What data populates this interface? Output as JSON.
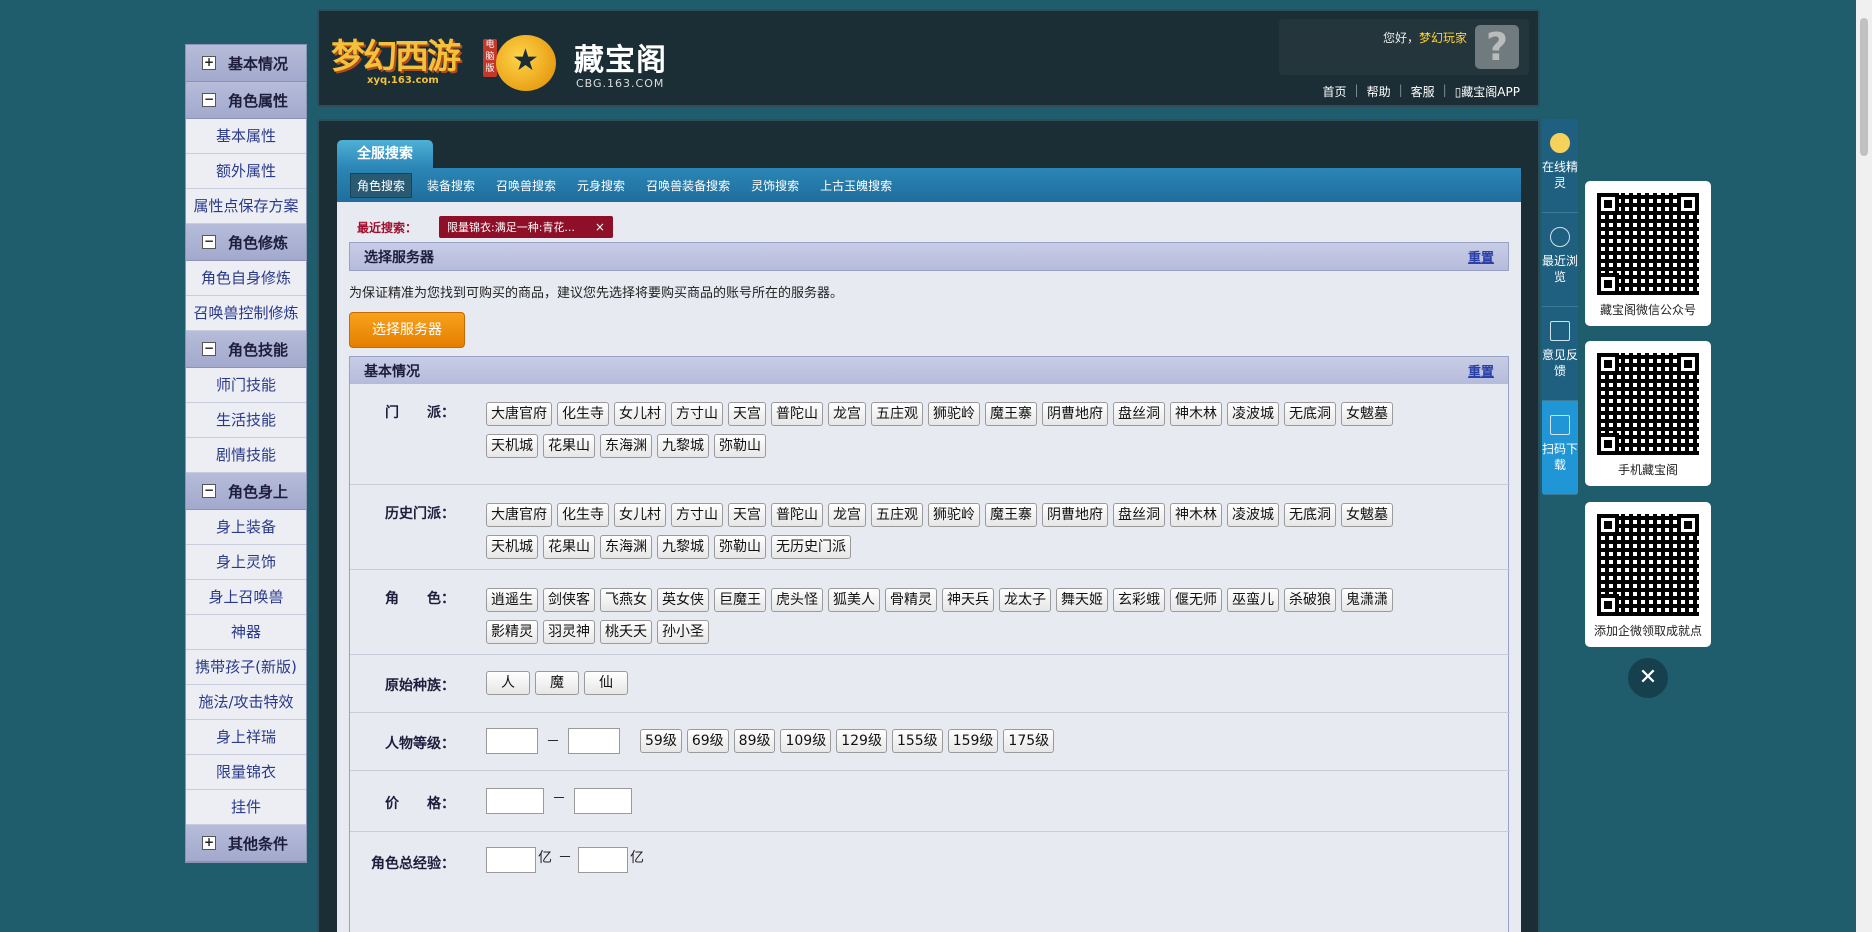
{
  "sidebar": {
    "groups": [
      {
        "toggle": "+",
        "label": "基本情况",
        "items": []
      },
      {
        "toggle": "−",
        "label": "角色属性",
        "items": [
          "基本属性",
          "额外属性",
          "属性点保存方案"
        ]
      },
      {
        "toggle": "−",
        "label": "角色修炼",
        "items": [
          "角色自身修炼",
          "召唤兽控制修炼"
        ]
      },
      {
        "toggle": "−",
        "label": "角色技能",
        "items": [
          "师门技能",
          "生活技能",
          "剧情技能"
        ]
      },
      {
        "toggle": "−",
        "label": "角色身上",
        "items": [
          "身上装备",
          "身上灵饰",
          "身上召唤兽",
          "神器",
          "携带孩子(新版)",
          "施法/攻击特效",
          "身上祥瑞",
          "限量锦衣",
          "挂件"
        ]
      },
      {
        "toggle": "+",
        "label": "其他条件",
        "items": []
      }
    ]
  },
  "header": {
    "logo1_brand": "梦幻西游",
    "logo1_url": "xyq.163.com",
    "logo1_tag": "电脑版",
    "logo2_name": "藏宝阁",
    "logo2_url": "CBG.163.COM",
    "greeting": "您好，",
    "username": "梦幻玩家",
    "help_icon": "?",
    "links": [
      "首页",
      "帮助",
      "客服",
      "▯藏宝阁APP"
    ]
  },
  "main": {
    "tab_title": "全服搜索",
    "subtabs": [
      "角色搜索",
      "装备搜索",
      "召唤兽搜索",
      "元身搜索",
      "召唤兽装备搜索",
      "灵饰搜索",
      "上古玉魄搜索"
    ],
    "recent_label": "最近搜索：",
    "recent_chip": "限量锦衣:满足一种:青花...",
    "recent_chip_close": "×",
    "server_panel_title": "选择服务器",
    "reset_label": "重置",
    "hint": "为保证精准为您找到可购买的商品，建议您先选择将要购买商品的账号所在的服务器。",
    "select_server_button": "选择服务器",
    "basic_panel_title": "基本情况",
    "rows": {
      "school_label": "门　　派：",
      "schools": [
        "大唐官府",
        "化生寺",
        "女儿村",
        "方寸山",
        "天宫",
        "普陀山",
        "龙宫",
        "五庄观",
        "狮驼岭",
        "魔王寨",
        "阴曹地府",
        "盘丝洞",
        "神木林",
        "凌波城",
        "无底洞",
        "女魃墓",
        "天机城",
        "花果山",
        "东海渊",
        "九黎城",
        "弥勒山"
      ],
      "history_label": "历史门派：",
      "history_schools": [
        "大唐官府",
        "化生寺",
        "女儿村",
        "方寸山",
        "天宫",
        "普陀山",
        "龙宫",
        "五庄观",
        "狮驼岭",
        "魔王寨",
        "阴曹地府",
        "盘丝洞",
        "神木林",
        "凌波城",
        "无底洞",
        "女魃墓",
        "天机城",
        "花果山",
        "东海渊",
        "九黎城",
        "弥勒山",
        "无历史门派"
      ],
      "role_label": "角　　色：",
      "roles": [
        "逍遥生",
        "剑侠客",
        "飞燕女",
        "英女侠",
        "巨魔王",
        "虎头怪",
        "狐美人",
        "骨精灵",
        "神天兵",
        "龙太子",
        "舞天姬",
        "玄彩蛾",
        "偃无师",
        "巫蛮儿",
        "杀破狼",
        "鬼潇潇",
        "影精灵",
        "羽灵神",
        "桃夭夭",
        "孙小圣"
      ],
      "race_label": "原始种族：",
      "races": [
        "人",
        "魔",
        "仙"
      ],
      "level_label": "人物等级：",
      "level_dash": "－",
      "levels": [
        "59级",
        "69级",
        "89级",
        "109级",
        "129级",
        "155级",
        "159级",
        "175级"
      ],
      "price_label": "价　　格：",
      "price_dash": "－",
      "exp_label": "角色总经验：",
      "exp_unit": "亿",
      "exp_dash": "－"
    }
  },
  "rightbar": {
    "items": [
      "在线精灵",
      "最近浏览",
      "意见反馈",
      "扫码下载"
    ],
    "qr_captions": [
      "藏宝阁微信公众号",
      "手机藏宝阁",
      "添加企微领取成就点"
    ],
    "close": "✕"
  }
}
